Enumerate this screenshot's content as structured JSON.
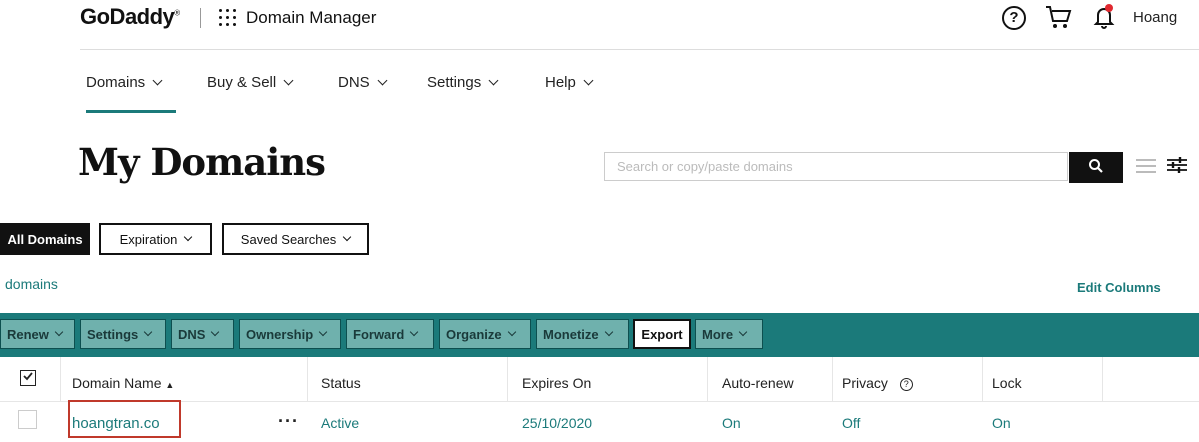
{
  "header": {
    "logo": "GoDaddy",
    "app_title": "Domain Manager",
    "user_name": "Hoang"
  },
  "nav": {
    "items": [
      {
        "label": "Domains",
        "active": true
      },
      {
        "label": "Buy & Sell"
      },
      {
        "label": "DNS"
      },
      {
        "label": "Settings"
      },
      {
        "label": "Help"
      }
    ]
  },
  "page": {
    "title": "My Domains",
    "search_placeholder": "Search or copy/paste domains"
  },
  "filters": {
    "all_domains": "All Domains",
    "expiration": "Expiration",
    "saved_searches": "Saved Searches"
  },
  "domains_label": "domains",
  "edit_columns": "Edit Columns",
  "toolbar": {
    "items": [
      "Renew",
      "Settings",
      "DNS",
      "Ownership",
      "Forward",
      "Organize",
      "Monetize",
      "Export",
      "More"
    ]
  },
  "table": {
    "headers": {
      "domain_name": "Domain Name",
      "status": "Status",
      "expires_on": "Expires On",
      "auto_renew": "Auto-renew",
      "privacy": "Privacy",
      "lock": "Lock"
    },
    "rows": [
      {
        "domain_name": "hoangtran.co",
        "status": "Active",
        "expires_on": "25/10/2020",
        "auto_renew": "On",
        "privacy": "Off",
        "lock": "On"
      }
    ]
  },
  "colors": {
    "accent": "#1b7a7a",
    "toolbar_button": "#6fb1ad",
    "highlight": "#c0392b"
  }
}
